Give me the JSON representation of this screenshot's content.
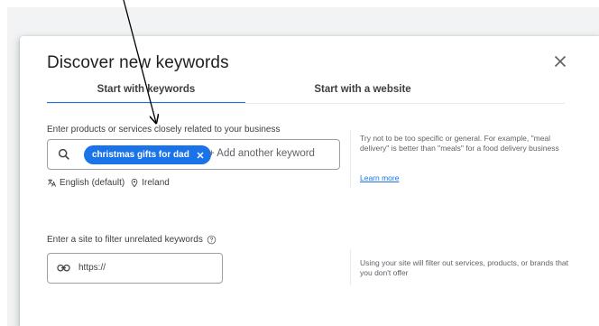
{
  "dialog": {
    "title": "Discover new keywords",
    "close_icon": "close-icon"
  },
  "tabs": [
    {
      "label": "Start with keywords",
      "selected": true
    },
    {
      "label": "Start with a website",
      "selected": false
    }
  ],
  "keywords_section": {
    "label": "Enter products or services closely related to your business",
    "chips": [
      {
        "label": "christmas gifts for dad"
      }
    ],
    "input_placeholder": "+ Add another keyword",
    "language": "English (default)",
    "location": "Ireland",
    "hint": "Try not to be too specific or general. For example, \"meal delivery\" is better than \"meals\" for a food delivery business",
    "learn_more": "Learn more"
  },
  "site_section": {
    "label": "Enter a site to filter unrelated keywords",
    "input_value": "https://",
    "hint": "Using your site will filter out services, products, or brands that you don't offer"
  },
  "colors": {
    "accent": "#1a73e8",
    "backdrop": "#f1f3f4"
  }
}
